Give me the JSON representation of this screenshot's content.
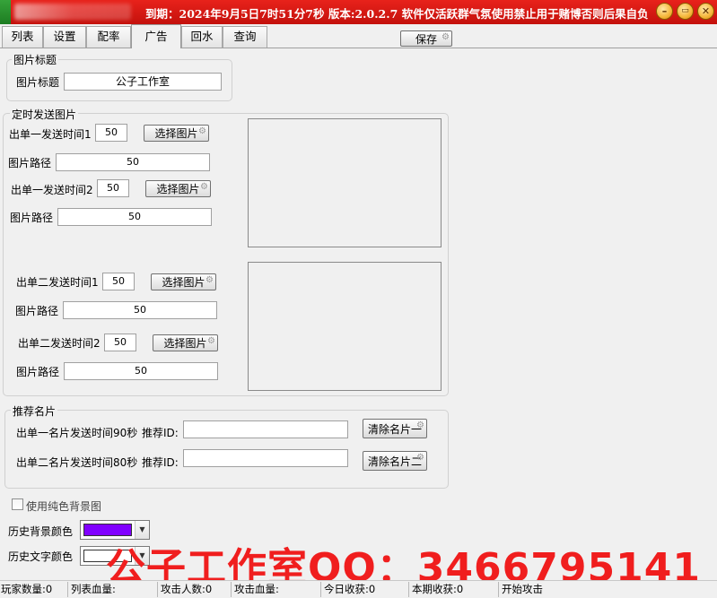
{
  "titlebar": {
    "title": "到期：2024年9月5日7时51分7秒 版本:2.0.2.7 软件仅活跃群气氛使用禁止用于赌博否则后果自负",
    "minimize": "–",
    "restore": "▭",
    "close": "✕"
  },
  "tabs": [
    "列表",
    "设置",
    "配率",
    "广告",
    "回水",
    "查询"
  ],
  "save_label": "保存",
  "pic_title_group": {
    "legend": "图片标题",
    "label": "图片标题",
    "value": "公子工作室"
  },
  "timed_group": {
    "legend": "定时发送图片",
    "choose_label": "选择图片",
    "path_label": "图片路径",
    "rows": [
      {
        "time_label": "出单一发送时间1",
        "time_value": "50",
        "path_value": "50"
      },
      {
        "time_label": "出单一发送时间2",
        "time_value": "50",
        "path_value": "50"
      },
      {
        "time_label": "出单二发送时间1",
        "time_value": "50",
        "path_value": "50"
      },
      {
        "time_label": "出单二发送时间2",
        "time_value": "50",
        "path_value": "50"
      }
    ]
  },
  "card_group": {
    "legend": "推荐名片",
    "rows": [
      {
        "label": "出单一名片发送时间90秒",
        "id_label": "推荐ID:",
        "id_value": "",
        "clear_label": "清除名片一"
      },
      {
        "label": "出单二名片发送时间80秒",
        "id_label": "推荐ID:",
        "id_value": "",
        "clear_label": "清除名片二"
      }
    ]
  },
  "bg": {
    "checkbox_label": "使用纯色背景图",
    "history_bg_label": "历史背景颜色",
    "history_bg_color": "#8000ff",
    "history_text_label": "历史文字颜色",
    "history_text_color": "#ffffff"
  },
  "watermark": "公子工作室QQ：3466795141",
  "statusbar": [
    "玩家数量:0",
    "列表血量:",
    "攻击人数:0",
    "攻击血量:",
    "今日收获:0",
    "本期收获:0",
    "开始攻击"
  ]
}
